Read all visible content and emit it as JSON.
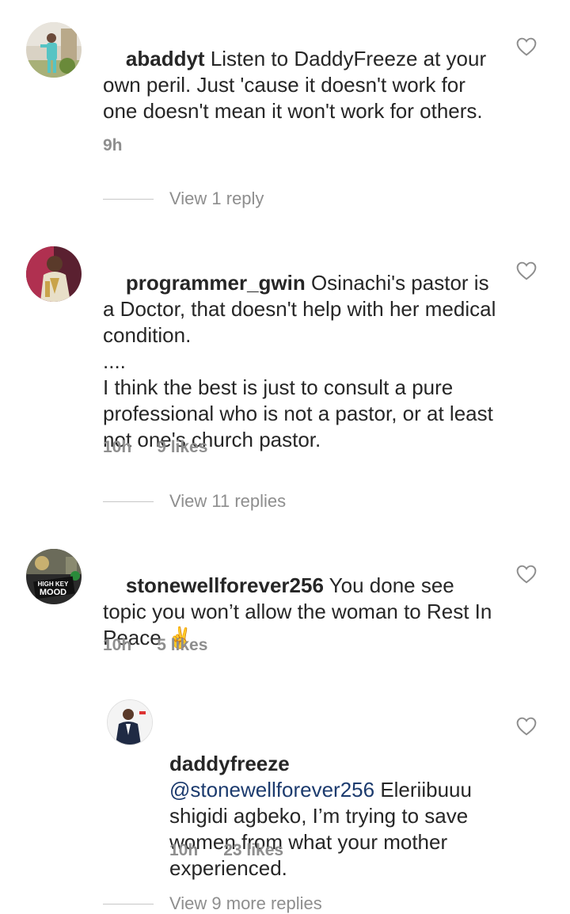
{
  "comments": [
    {
      "username": "abaddyt",
      "text": " Listen to DaddyFreeze at your own peril. Just 'cause it doesn't work for one doesn't mean it won't work for others.",
      "time": "9h",
      "likes": "",
      "view_replies": "View 1 reply",
      "avatar_icon": "avatar-photo"
    },
    {
      "username": "programmer_gwin",
      "text": " Osinachi's pastor is a Doctor, that doesn't help with her medical condition.\n....\nI think the best is just to consult a pure professional who is not a pastor, or at least not one's church pastor.",
      "time": "10h",
      "likes": "9 likes",
      "view_replies": "View 11 replies",
      "avatar_icon": "avatar-photo"
    },
    {
      "username": "stonewellforever256",
      "text": " You done see topic you won’t allow the woman to Rest In Peace ",
      "emoji": "✌️",
      "time": "10h",
      "likes": "5 likes",
      "avatar_icon": "avatar-photo",
      "avatar_badge_text": "HIGH KEY MOOD"
    }
  ],
  "reply": {
    "username": "daddyfreeze",
    "mention": "@stonewellforever256",
    "text": " Eleriibuuu shigidi agbeko, I’m trying to save women from what your mother experienced.",
    "time": "10h",
    "likes": "23 likes",
    "view_replies": "View 9 more replies",
    "avatar_icon": "avatar-photo"
  },
  "colors": {
    "text": "#262626",
    "meta": "#8e8e8e",
    "mention": "#1c3b6e",
    "divider": "#c7c7c7"
  }
}
